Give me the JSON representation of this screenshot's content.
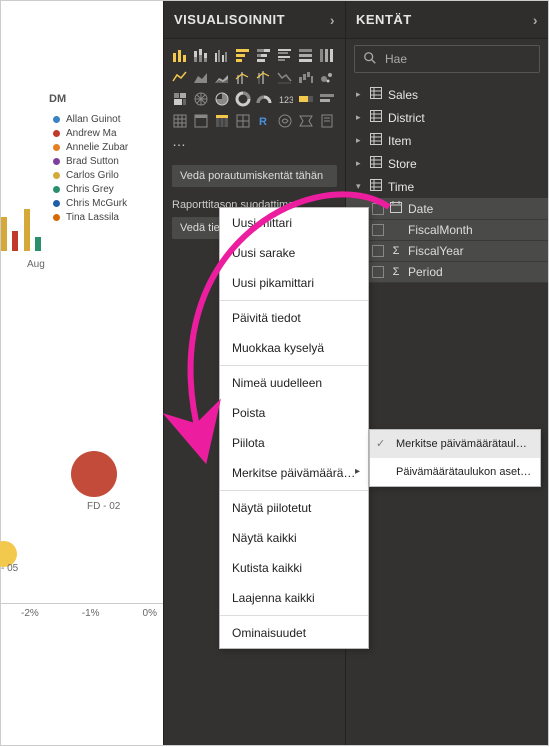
{
  "canvas": {
    "legend_title": "DM",
    "legend_items": [
      {
        "label": "Allan Guinot",
        "color": "#3b82c4"
      },
      {
        "label": "Andrew Ma",
        "color": "#c0392b"
      },
      {
        "label": "Annelie Zubar",
        "color": "#e67e22"
      },
      {
        "label": "Brad Sutton",
        "color": "#7f3fa0"
      },
      {
        "label": "Carlos Grilo",
        "color": "#d4a93a"
      },
      {
        "label": "Chris Grey",
        "color": "#2a8f6d"
      },
      {
        "label": "Chris McGurk",
        "color": "#1f5fa8"
      },
      {
        "label": "Tina Lassila",
        "color": "#d46a00"
      }
    ],
    "month_label": "Aug",
    "scatter_label": "FD - 02",
    "neg5": "- 05",
    "axis_ticks": [
      "-2%",
      "-1%",
      "0%"
    ]
  },
  "panels": {
    "viz_title": "VISUALISOINNIT",
    "fields_title": "KENTÄT"
  },
  "search": {
    "placeholder": "Hae"
  },
  "tables": [
    {
      "name": "Sales",
      "expanded": false
    },
    {
      "name": "District",
      "expanded": false
    },
    {
      "name": "Item",
      "expanded": false
    },
    {
      "name": "Store",
      "expanded": false
    },
    {
      "name": "Time",
      "expanded": true,
      "fields": [
        {
          "name": "Date",
          "icon": "calendar"
        },
        {
          "name": "FiscalMonth",
          "icon": "none"
        },
        {
          "name": "FiscalYear",
          "icon": "sigma"
        },
        {
          "name": "Period",
          "icon": "sigma"
        }
      ]
    }
  ],
  "context_menu": {
    "items": [
      {
        "label": "Uusi mittari"
      },
      {
        "label": "Uusi sarake"
      },
      {
        "label": "Uusi pikamittari"
      },
      {
        "sep": true
      },
      {
        "label": "Päivitä tiedot"
      },
      {
        "label": "Muokkaa kyselyä"
      },
      {
        "sep": true
      },
      {
        "label": "Nimeä uudelleen"
      },
      {
        "label": "Poista"
      },
      {
        "label": "Piilota"
      },
      {
        "label": "Merkitse päivämäärä…",
        "submenu": true
      },
      {
        "sep": true
      },
      {
        "label": "Näytä piilotetut"
      },
      {
        "label": "Näytä kaikki"
      },
      {
        "label": "Kutista kaikki"
      },
      {
        "label": "Laajenna kaikki"
      },
      {
        "sep": true
      },
      {
        "label": "Ominaisuudet"
      }
    ]
  },
  "submenu": {
    "items": [
      {
        "label": "Merkitse päivämäärätaulukoksi",
        "selected": true
      },
      {
        "label": "Päivämäärätaulukon asetukset",
        "selected": false
      }
    ]
  },
  "filters": {
    "drill": "Vedä porautumiskentät tähän",
    "report_label": "Raporttitason suodattimet",
    "report_drop": "Vedä tietokentät tähän"
  }
}
